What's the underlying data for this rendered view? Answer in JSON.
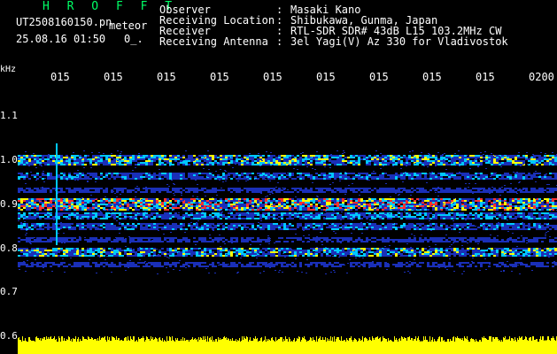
{
  "header": {
    "brand": "H R O F F T",
    "filename": "UT2508160150.pn",
    "mode": "meteor",
    "datetime": "25.08.16 01:50",
    "extra": "0_."
  },
  "meta": {
    "rows": [
      {
        "label": "Observer",
        "value": "Masaki Kano"
      },
      {
        "label": "Receiving Location",
        "value": "Shibukawa, Gunma, Japan"
      },
      {
        "label": "Receiver",
        "value": "RTL-SDR SDR# 43dB L15 103.2MHz CW"
      },
      {
        "label": "Receiving Antenna",
        "value": "3el Yagi(V) Az 330 for Vladivostok"
      }
    ],
    "separator": ":"
  },
  "axis": {
    "unit": "kHz",
    "time_ticks": [
      "015",
      "015",
      "015",
      "015",
      "015",
      "015",
      "015",
      "015",
      "015",
      "0200"
    ],
    "freq_ticks": [
      "1.1",
      "1.0",
      "0.9",
      "0.8",
      "0.7",
      "0.6"
    ]
  },
  "colors": {
    "background": "#000000",
    "brand": "#00ff66",
    "text": "#ffffff",
    "signal_weak": "#1a2fb8",
    "signal_mid": "#00c8ff",
    "signal_strong": "#ffff00",
    "signal_peak": "#ff3030",
    "power_bar": "#ffff00"
  }
}
